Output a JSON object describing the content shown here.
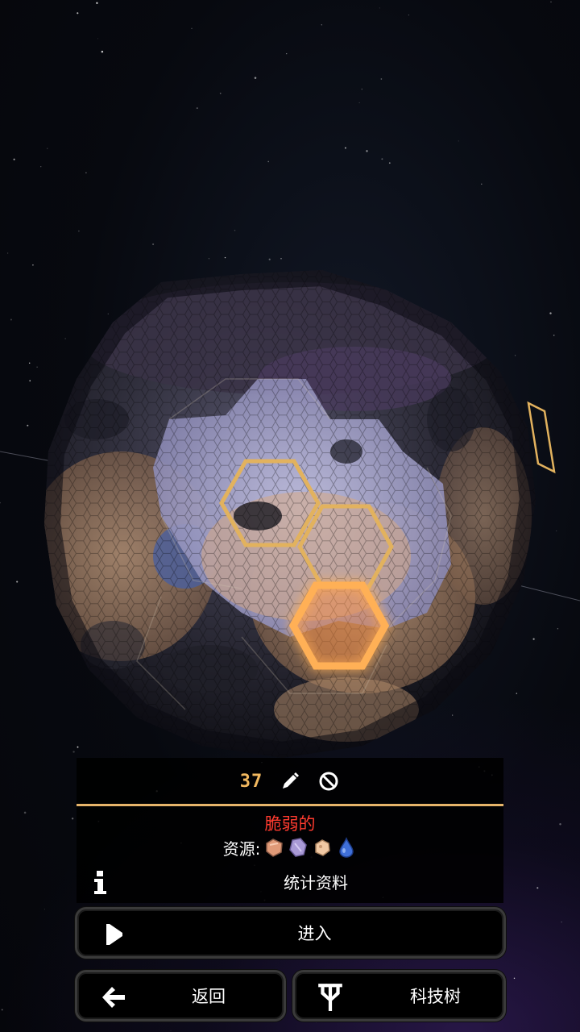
{
  "colors": {
    "accent": "#e6b46a",
    "count": "#f2b85f",
    "danger": "#ff3b2f",
    "selected_glow": "#ff8a2a"
  },
  "panel": {
    "count": "37",
    "edit_icon": "pencil-icon",
    "block_icon": "no-entry-icon",
    "tile_name": "脆弱的",
    "resources_label": "资源:",
    "resources": [
      {
        "name": "copper-ore-icon",
        "color": "#e09a78"
      },
      {
        "name": "purple-crystal-icon",
        "color": "#a99ad6"
      },
      {
        "name": "beige-ore-icon",
        "color": "#f1c9a4"
      },
      {
        "name": "water-drop-icon",
        "color": "#3f6fd8"
      }
    ],
    "stats_label": "统计资料"
  },
  "buttons": {
    "enter": "进入",
    "back": "返回",
    "tech_tree": "科技树"
  }
}
